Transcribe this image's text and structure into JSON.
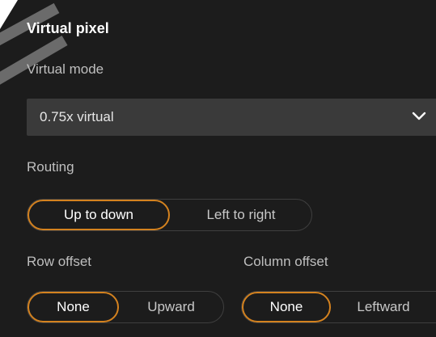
{
  "section": {
    "title": "Virtual pixel",
    "virtual_mode": {
      "label": "Virtual mode",
      "selected": "0.75x virtual",
      "icon": "chevron-down-icon"
    },
    "routing": {
      "label": "Routing",
      "options": [
        "Up to down",
        "Left to right"
      ],
      "selected": "Up to down"
    },
    "row_offset": {
      "label": "Row offset",
      "options": [
        "None",
        "Upward"
      ],
      "selected": "None"
    },
    "column_offset": {
      "label": "Column offset",
      "options": [
        "None",
        "Leftward"
      ],
      "selected": "None"
    }
  },
  "colors": {
    "background": "#1c1c1c",
    "accent": "#d4821f",
    "select_bg": "#3a3a3a"
  }
}
